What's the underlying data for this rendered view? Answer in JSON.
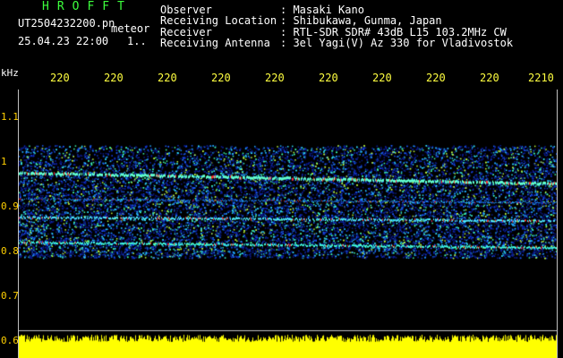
{
  "header": {
    "app_title": "HROFFT",
    "filename": "UT2504232200.pn",
    "mode": "meteor",
    "datetime": "25.04.23 22:00",
    "count": "1.."
  },
  "info": [
    {
      "key": "Observer",
      "value": ": Masaki Kano"
    },
    {
      "key": "Receiving Location",
      "value": ": Shibukawa, Gunma, Japan"
    },
    {
      "key": "Receiver",
      "value": ": RTL-SDR SDR# 43dB L15 103.2MHz CW"
    },
    {
      "key": "Receiving Antenna",
      "value": ": 3el Yagi(V) Az 330 for Vladivostok"
    }
  ],
  "axes": {
    "unit": "kHz",
    "y_labels": [
      "1.1",
      "1",
      "0.9",
      "0.8",
      "0.7",
      "0.6"
    ],
    "x_labels": [
      "220",
      "220",
      "220",
      "220",
      "220",
      "220",
      "220",
      "220",
      "220",
      "2210"
    ]
  },
  "colors": {
    "background": "#000000",
    "title": "#3dff3d",
    "axis_label": "#ffd000",
    "noise_bar": "#ffff00",
    "echo": "#ff3030"
  }
}
